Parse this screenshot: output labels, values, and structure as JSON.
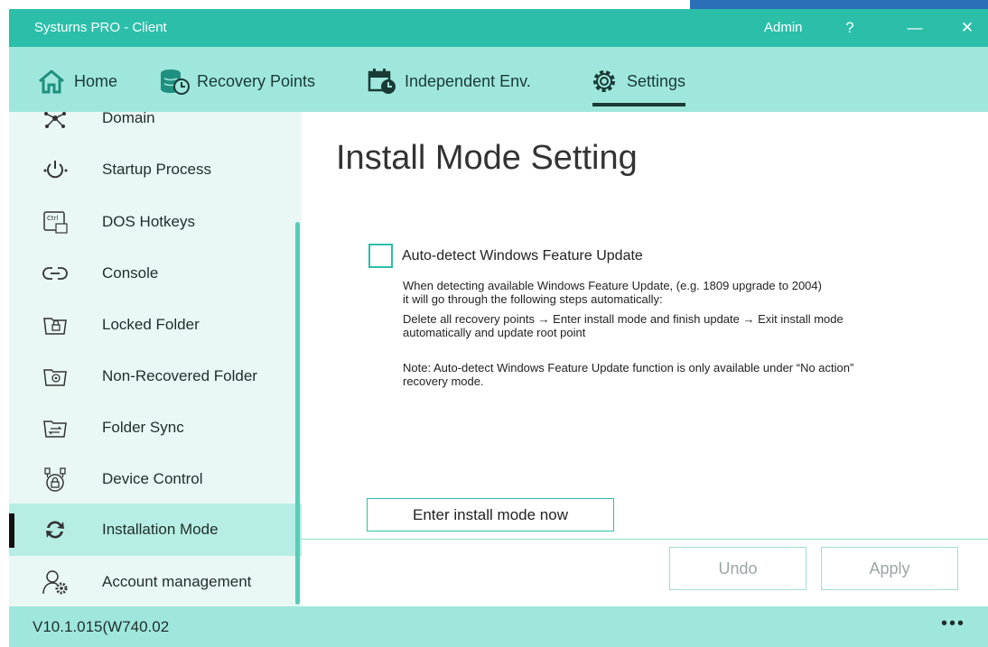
{
  "window": {
    "title": "Systurns PRO - Client",
    "user": "Admin",
    "help": "?",
    "minimize": "—",
    "close": "✕"
  },
  "nav": {
    "tabs": [
      {
        "label": "Home",
        "icon": "home-icon"
      },
      {
        "label": "Recovery Points",
        "icon": "database-restore-icon"
      },
      {
        "label": "Independent Env.",
        "icon": "calendar-clock-icon"
      },
      {
        "label": "Settings",
        "icon": "gear-icon",
        "active": true
      }
    ]
  },
  "sidebar": {
    "items": [
      {
        "label": "Domain",
        "icon": "network-icon"
      },
      {
        "label": "Startup Process",
        "icon": "power-startup-icon"
      },
      {
        "label": "DOS Hotkeys",
        "icon": "ctrl-key-icon"
      },
      {
        "label": "Console",
        "icon": "link-console-icon"
      },
      {
        "label": "Locked Folder",
        "icon": "locked-folder-icon"
      },
      {
        "label": "Non-Recovered Folder",
        "icon": "nonrecovered-folder-icon"
      },
      {
        "label": "Folder Sync",
        "icon": "folder-sync-icon"
      },
      {
        "label": "Device Control",
        "icon": "device-control-icon"
      },
      {
        "label": "Installation Mode",
        "icon": "installation-mode-icon",
        "active": true
      },
      {
        "label": "Account management",
        "icon": "account-gear-icon"
      }
    ]
  },
  "main": {
    "title": "Install Mode Setting",
    "auto_detect": {
      "label": "Auto-detect Windows Feature Update",
      "checked": false
    },
    "description": [
      "When detecting available Windows Feature Update, (e.g. 1809 upgrade to 2004)",
      "it will go through the following steps automatically:",
      "Delete all recovery points → Enter install mode and finish update → Exit install mode",
      "automatically and update root point"
    ],
    "note": [
      "Note: Auto-detect Windows Feature Update function is only available under “No action”",
      "recovery mode."
    ],
    "enter_button": "Enter install mode now",
    "undo_button": "Undo",
    "apply_button": "Apply"
  },
  "footer": {
    "version": "V10.1.015(W740.02",
    "more": "•••"
  },
  "colors": {
    "titlebar": "#2bbfa9",
    "navbar": "#9fe7dc",
    "sidebar": "#e9f8f5",
    "active_item": "#b7eee4",
    "accent": "#2bbfa9"
  }
}
